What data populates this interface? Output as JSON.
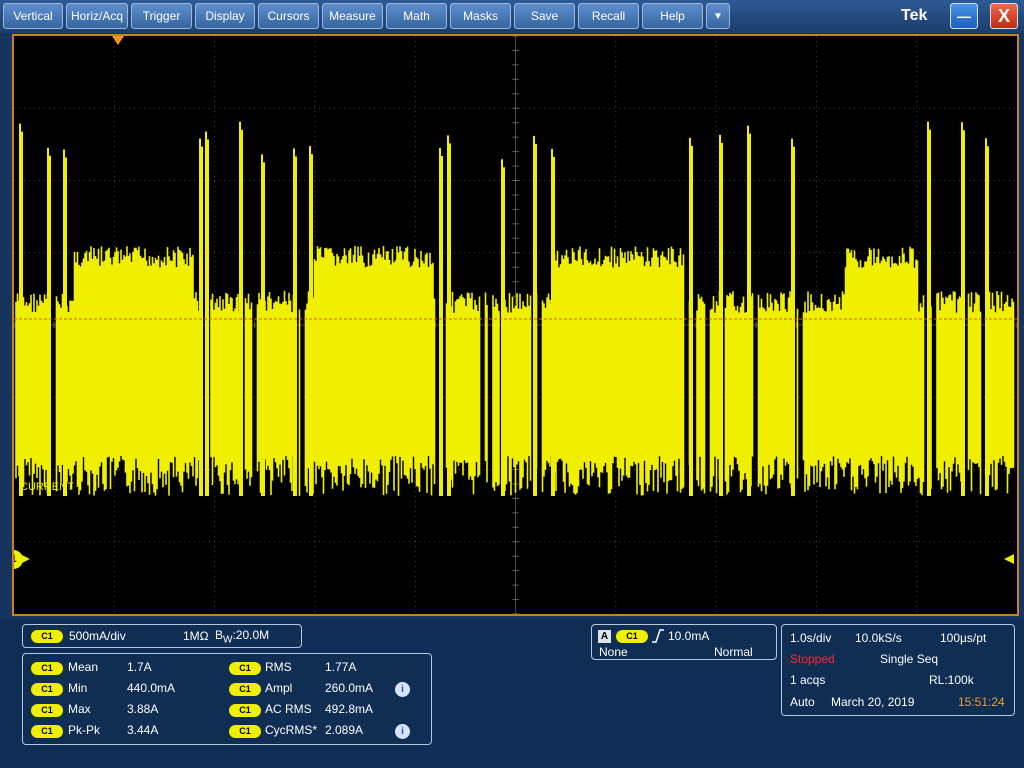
{
  "menu": {
    "items": [
      {
        "label": "Vertical"
      },
      {
        "label": "Horiz/Acq"
      },
      {
        "label": "Trigger"
      },
      {
        "label": "Display"
      },
      {
        "label": "Cursors"
      },
      {
        "label": "Measure"
      },
      {
        "label": "Math"
      },
      {
        "label": "Masks"
      },
      {
        "label": "Save"
      },
      {
        "label": "Recall"
      },
      {
        "label": "Help"
      }
    ],
    "dropdown_icon": "▼",
    "brand": "Tek",
    "minimize_icon": "—",
    "close_icon": "X"
  },
  "scope": {
    "channel_label": "CURRENT",
    "channel_marker": "1",
    "trace_color": "#f0ef00",
    "grid_color": "#444444",
    "trigger_level_color": "#cc6a1d"
  },
  "vertical": {
    "chip": "C1",
    "scale": "500mA/div",
    "impedance": "1MΩ",
    "bw_prefix": "B",
    "bw_sub": "W",
    "bw_value": ":20.0M"
  },
  "measurements": {
    "rows": [
      {
        "chip": "C1",
        "label": "Mean",
        "value": "1.7A",
        "chip2": "C1",
        "label2": "RMS",
        "value2": "1.77A"
      },
      {
        "chip": "C1",
        "label": "Min",
        "value": "440.0mA",
        "chip2": "C1",
        "label2": "Ampl",
        "value2": "260.0mA"
      },
      {
        "chip": "C1",
        "label": "Max",
        "value": "3.88A",
        "chip2": "C1",
        "label2": "AC RMS",
        "value2": "492.8mA"
      },
      {
        "chip": "C1",
        "label": "Pk-Pk",
        "value": "3.44A",
        "chip2": "C1",
        "label2": "CycRMS*",
        "value2": "2.089A"
      }
    ],
    "info_icon": "i"
  },
  "trigger": {
    "mode_badge": "A",
    "chip": "C1",
    "slope_icon": "rising-edge",
    "level": "10.0mA",
    "coupling": "None",
    "sweep": "Normal"
  },
  "acquisition": {
    "timebase": "1.0s/div",
    "sample_rate": "10.0kS/s",
    "resolution": "100µs/pt",
    "state": "Stopped",
    "state_color": "#ff2a2a",
    "sequence": "Single Seq",
    "acqs": "1 acqs",
    "record_length": "RL:100k",
    "mode": "Auto",
    "date": "March 20, 2019",
    "time": "15:51:24",
    "time_color": "#f0a028"
  }
}
